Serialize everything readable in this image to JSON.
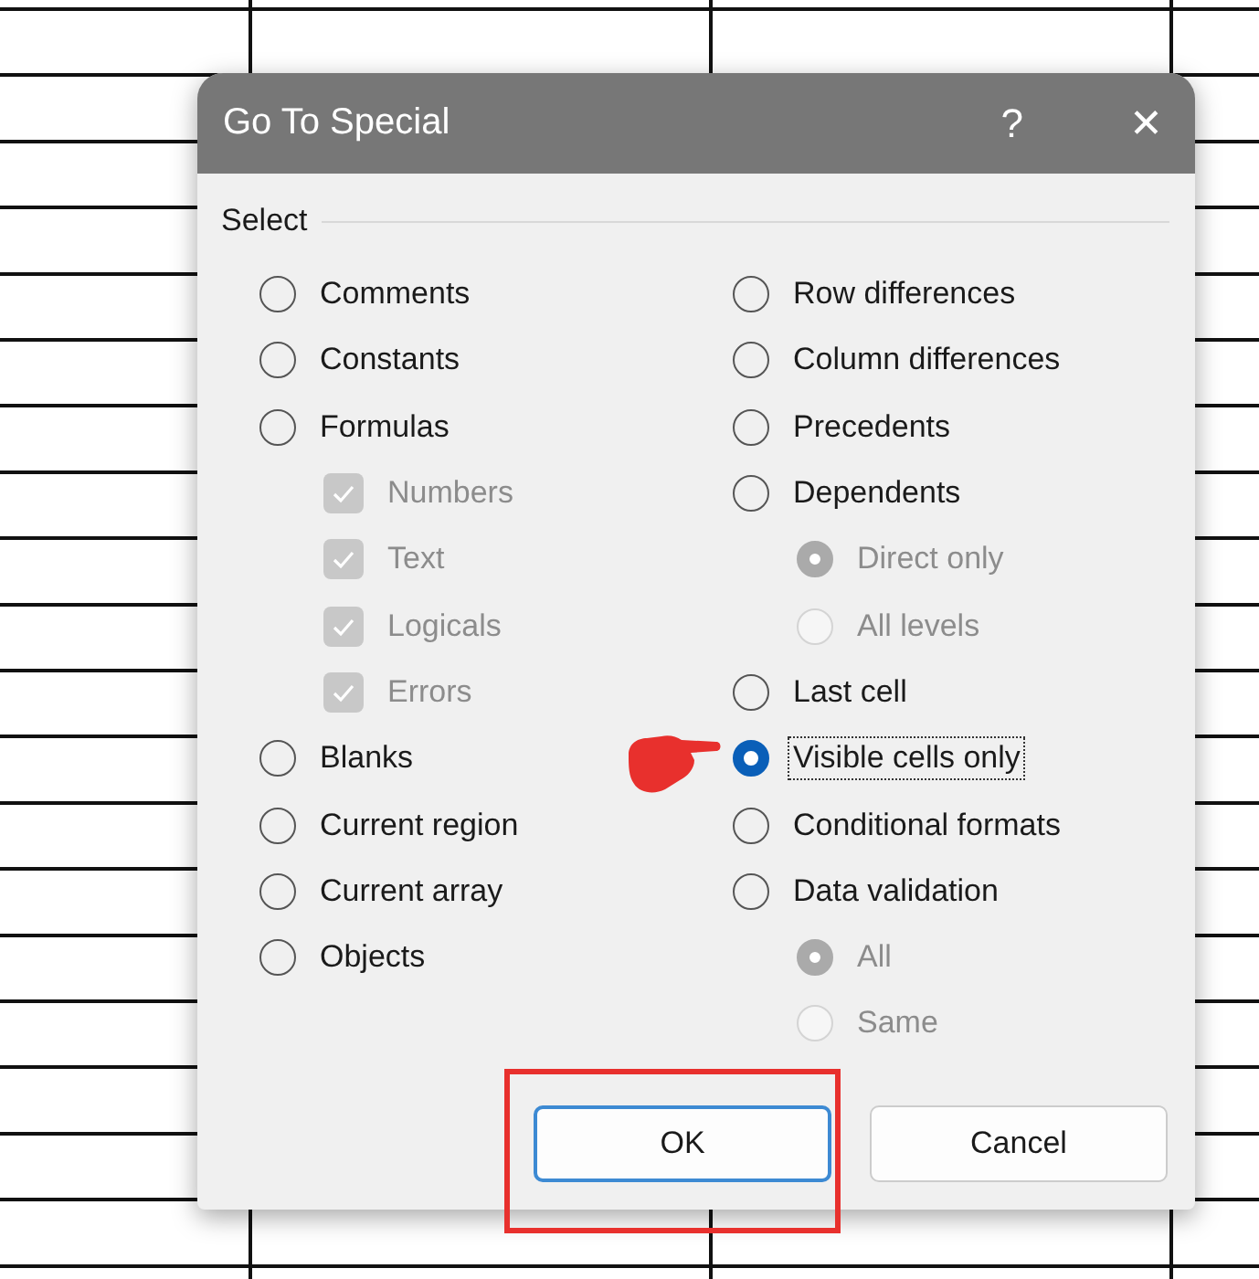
{
  "dialog": {
    "title": "Go To Special",
    "help": "?",
    "close": "✕"
  },
  "group": {
    "label": "Select"
  },
  "left_column": [
    {
      "kind": "radio",
      "label": "Comments",
      "selected": false,
      "disabled": false,
      "focused": false
    },
    {
      "kind": "radio",
      "label": "Constants",
      "selected": false,
      "disabled": false,
      "focused": false
    },
    {
      "kind": "radio",
      "label": "Formulas",
      "selected": false,
      "disabled": false,
      "focused": false,
      "children": [
        {
          "kind": "checkbox",
          "label": "Numbers",
          "checked": true,
          "disabled": true
        },
        {
          "kind": "checkbox",
          "label": "Text",
          "checked": true,
          "disabled": true
        },
        {
          "kind": "checkbox",
          "label": "Logicals",
          "checked": true,
          "disabled": true
        },
        {
          "kind": "checkbox",
          "label": "Errors",
          "checked": true,
          "disabled": true
        }
      ]
    },
    {
      "kind": "radio",
      "label": "Blanks",
      "selected": false,
      "disabled": false,
      "focused": false
    },
    {
      "kind": "radio",
      "label": "Current region",
      "selected": false,
      "disabled": false,
      "focused": false
    },
    {
      "kind": "radio",
      "label": "Current array",
      "selected": false,
      "disabled": false,
      "focused": false
    },
    {
      "kind": "radio",
      "label": "Objects",
      "selected": false,
      "disabled": false,
      "focused": false
    }
  ],
  "right_column": [
    {
      "kind": "radio",
      "label": "Row differences",
      "selected": false,
      "disabled": false,
      "focused": false
    },
    {
      "kind": "radio",
      "label": "Column differences",
      "selected": false,
      "disabled": false,
      "focused": false
    },
    {
      "kind": "radio",
      "label": "Precedents",
      "selected": false,
      "disabled": false,
      "focused": false
    },
    {
      "kind": "radio",
      "label": "Dependents",
      "selected": false,
      "disabled": false,
      "focused": false,
      "children": [
        {
          "kind": "radio",
          "label": "Direct only",
          "selected": true,
          "disabled": true,
          "focused": false
        },
        {
          "kind": "radio",
          "label": "All levels",
          "selected": false,
          "disabled": true,
          "focused": false
        }
      ]
    },
    {
      "kind": "radio",
      "label": "Last cell",
      "selected": false,
      "disabled": false,
      "focused": false
    },
    {
      "kind": "radio",
      "label": "Visible cells only",
      "selected": true,
      "disabled": false,
      "focused": true
    },
    {
      "kind": "radio",
      "label": "Conditional formats",
      "selected": false,
      "disabled": false,
      "focused": false
    },
    {
      "kind": "radio",
      "label": "Data validation",
      "selected": false,
      "disabled": false,
      "focused": false,
      "children": [
        {
          "kind": "radio",
          "label": "All",
          "selected": true,
          "disabled": true,
          "focused": false
        },
        {
          "kind": "radio",
          "label": "Same",
          "selected": false,
          "disabled": true,
          "focused": false
        }
      ]
    }
  ],
  "buttons": [
    {
      "label": "OK",
      "default": true
    },
    {
      "label": "Cancel",
      "default": false
    }
  ]
}
